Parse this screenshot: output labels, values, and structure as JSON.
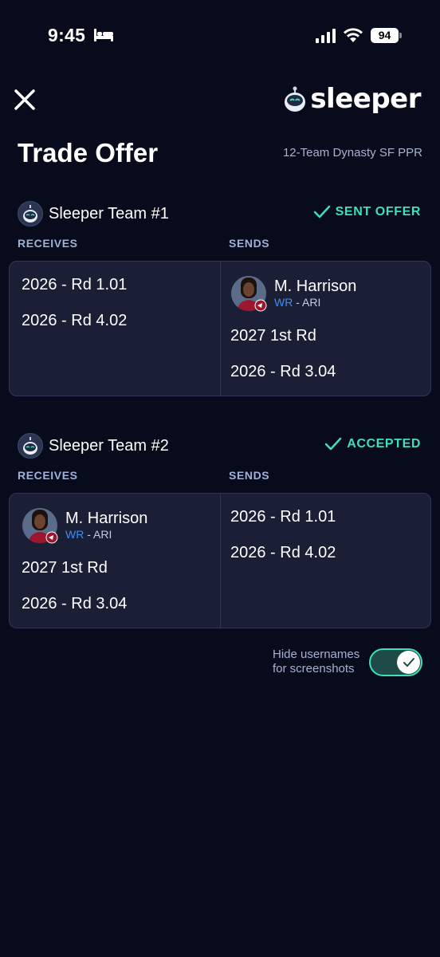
{
  "status_bar": {
    "time": "9:45",
    "battery": "94"
  },
  "header": {
    "logo_text": "sleeper",
    "title": "Trade Offer",
    "league": "12-Team Dynasty SF PPR"
  },
  "teams": [
    {
      "name": "Sleeper Team #1",
      "status": "SENT OFFER",
      "receives_label": "RECEIVES",
      "sends_label": "SENDS",
      "receives": [
        "2026 - Rd 1.01",
        "2026 - Rd 4.02"
      ],
      "sends_player": {
        "name": "M. Harrison",
        "position": "WR",
        "separator": " - ",
        "team": "ARI"
      },
      "sends": [
        "2027 1st Rd",
        "2026 - Rd 3.04"
      ]
    },
    {
      "name": "Sleeper Team #2",
      "status": "ACCEPTED",
      "receives_label": "RECEIVES",
      "sends_label": "SENDS",
      "receives_player": {
        "name": "M. Harrison",
        "position": "WR",
        "separator": " - ",
        "team": "ARI"
      },
      "receives": [
        "2027 1st Rd",
        "2026 - Rd 3.04"
      ],
      "sends": [
        "2026 - Rd 1.01",
        "2026 - Rd 4.02"
      ]
    }
  ],
  "toggle": {
    "label_line1": "Hide usernames",
    "label_line2": "for screenshots",
    "on": true
  },
  "colors": {
    "background": "#080b1b",
    "card": "#1a1f36",
    "accent": "#3ee0b9",
    "position": "#3f8ef5"
  }
}
